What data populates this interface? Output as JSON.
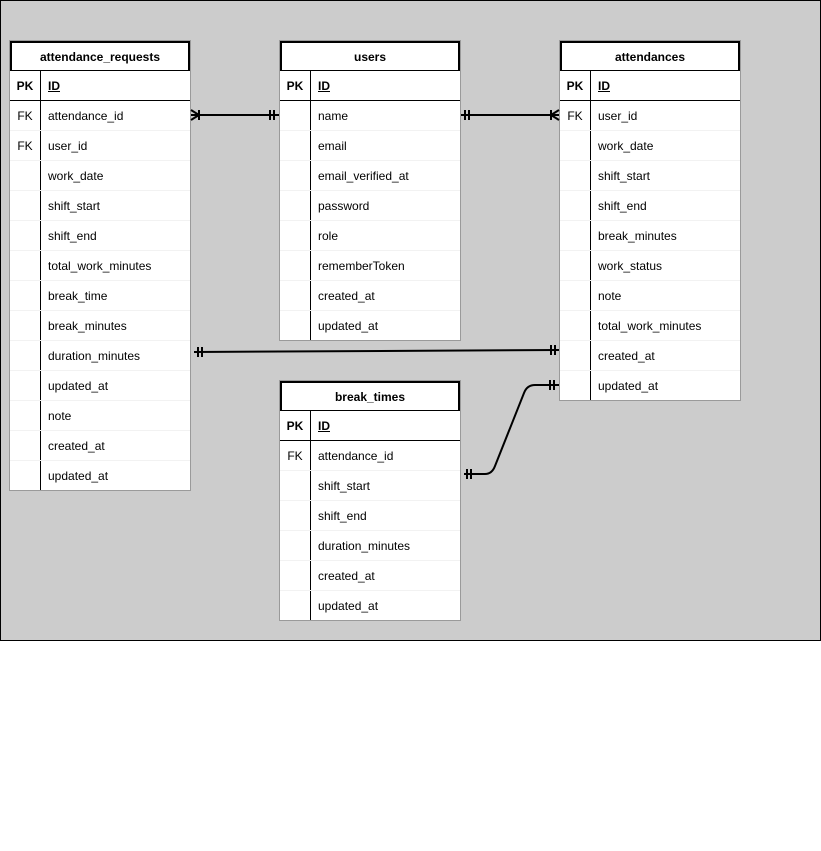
{
  "entities": [
    {
      "name": "attendance_requests",
      "pk": {
        "key": "PK",
        "field": "ID"
      },
      "fields": [
        {
          "key": "FK",
          "name": "attendance_id"
        },
        {
          "key": "FK",
          "name": "user_id"
        },
        {
          "key": "",
          "name": "work_date"
        },
        {
          "key": "",
          "name": "shift_start"
        },
        {
          "key": "",
          "name": "shift_end"
        },
        {
          "key": "",
          "name": "total_work_minutes"
        },
        {
          "key": "",
          "name": "break_time"
        },
        {
          "key": "",
          "name": "break_minutes"
        },
        {
          "key": "",
          "name": "duration_minutes"
        },
        {
          "key": "",
          "name": "updated_at"
        },
        {
          "key": "",
          "name": "note"
        },
        {
          "key": "",
          "name": "created_at"
        },
        {
          "key": "",
          "name": "updated_at"
        }
      ]
    },
    {
      "name": "users",
      "pk": {
        "key": "PK",
        "field": "ID"
      },
      "fields": [
        {
          "key": "",
          "name": "name"
        },
        {
          "key": "",
          "name": "email"
        },
        {
          "key": "",
          "name": "email_verified_at"
        },
        {
          "key": "",
          "name": "password"
        },
        {
          "key": "",
          "name": "role"
        },
        {
          "key": "",
          "name": "rememberToken"
        },
        {
          "key": "",
          "name": "created_at"
        },
        {
          "key": "",
          "name": "updated_at"
        }
      ]
    },
    {
      "name": "attendances",
      "pk": {
        "key": "PK",
        "field": "ID"
      },
      "fields": [
        {
          "key": "FK",
          "name": "user_id"
        },
        {
          "key": "",
          "name": "work_date"
        },
        {
          "key": "",
          "name": "shift_start"
        },
        {
          "key": "",
          "name": "shift_end"
        },
        {
          "key": "",
          "name": "break_minutes"
        },
        {
          "key": "",
          "name": "work_status"
        },
        {
          "key": "",
          "name": "note"
        },
        {
          "key": "",
          "name": "total_work_minutes"
        },
        {
          "key": "",
          "name": "created_at"
        },
        {
          "key": "",
          "name": "updated_at"
        }
      ]
    },
    {
      "name": "break_times",
      "pk": {
        "key": "PK",
        "field": "ID"
      },
      "fields": [
        {
          "key": "FK",
          "name": "attendance_id"
        },
        {
          "key": "",
          "name": "shift_start"
        },
        {
          "key": "",
          "name": "shift_end"
        },
        {
          "key": "",
          "name": "duration_minutes"
        },
        {
          "key": "",
          "name": "created_at"
        },
        {
          "key": "",
          "name": "updated_at"
        }
      ]
    }
  ],
  "relationships": [
    {
      "from": "attendance_requests.attendance_id",
      "from_cardinality": "one-or-many",
      "to": "users.name",
      "to_cardinality": "one-and-only-one"
    },
    {
      "from": "users.name",
      "from_cardinality": "one-and-only-one",
      "to": "attendances.user_id",
      "to_cardinality": "one-or-many"
    },
    {
      "from": "attendance_requests.duration_minutes",
      "from_cardinality": "one-and-only-one",
      "to": "attendances.created_at",
      "to_cardinality": "one-and-only-one"
    },
    {
      "from": "break_times.attendance_id",
      "from_cardinality": "one-and-only-one",
      "to": "attendances.updated_at",
      "to_cardinality": "one-and-only-one"
    }
  ]
}
